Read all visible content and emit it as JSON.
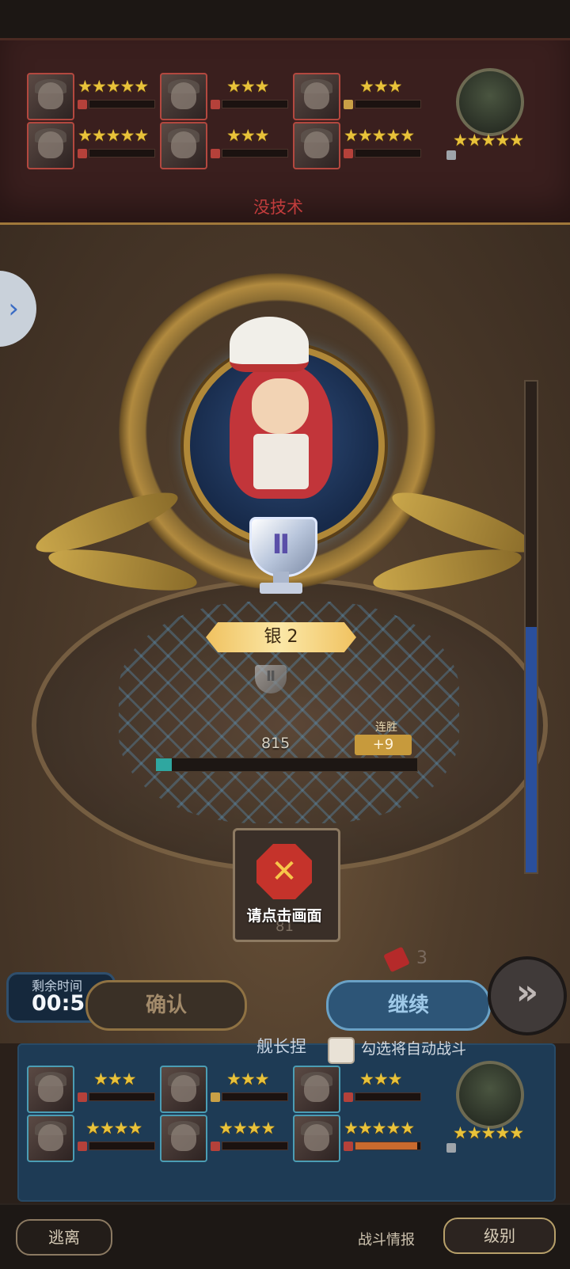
{
  "enemy_team": {
    "no_skill_label": "没技术",
    "members": [
      {
        "stars": 5,
        "icon": "red",
        "hp": 0
      },
      {
        "stars": 3,
        "icon": "red",
        "hp": 0
      },
      {
        "stars": 3,
        "icon": "gold",
        "hp": 0
      },
      {
        "stars": 5,
        "icon": "red",
        "hp": 0
      },
      {
        "stars": 3,
        "icon": "red",
        "hp": 0
      },
      {
        "stars": 5,
        "icon": "red",
        "hp": 0
      }
    ],
    "boss_stars": 5
  },
  "result": {
    "rank_name": "银 2",
    "trophy_numeral": "Ⅱ",
    "small_trophy_numeral": "Ⅱ",
    "points": "815",
    "streak_label": "连胜",
    "gain": "+9",
    "progress_fraction": 0.06,
    "tap_prompt": "请点击画面",
    "faint_number": "81"
  },
  "controls": {
    "timer_label": "剩余时间",
    "timer_value": "00:5",
    "confirm_label": "确认",
    "continue_label": "继续",
    "fast_forward_glyph": "»",
    "card_count": "3",
    "expand_glyph": "›",
    "captain_label": "舰长捏",
    "auto_battle_label": "勾选将自动战斗",
    "auto_battle_checked": false
  },
  "ally_team": {
    "members": [
      {
        "stars": 3,
        "icon": "red",
        "hp": 0
      },
      {
        "stars": 3,
        "icon": "gold",
        "hp": 0
      },
      {
        "stars": 3,
        "icon": "red",
        "hp": 0
      },
      {
        "stars": 4,
        "icon": "red",
        "hp": 0
      },
      {
        "stars": 4,
        "icon": "red",
        "hp": 0
      },
      {
        "stars": 5,
        "icon": "red",
        "hp": 0.95
      }
    ],
    "leader_stars": 5
  },
  "footer": {
    "escape_label": "逃离",
    "battle_info_label": "战斗情报",
    "level_label": "级别"
  },
  "colors": {
    "enemy_border": "#b3483f",
    "ally_border": "#4b9db4",
    "star": "#e8c23a",
    "rank_banner": "#f0c260",
    "gauge_fill": "#2a4f9c"
  }
}
